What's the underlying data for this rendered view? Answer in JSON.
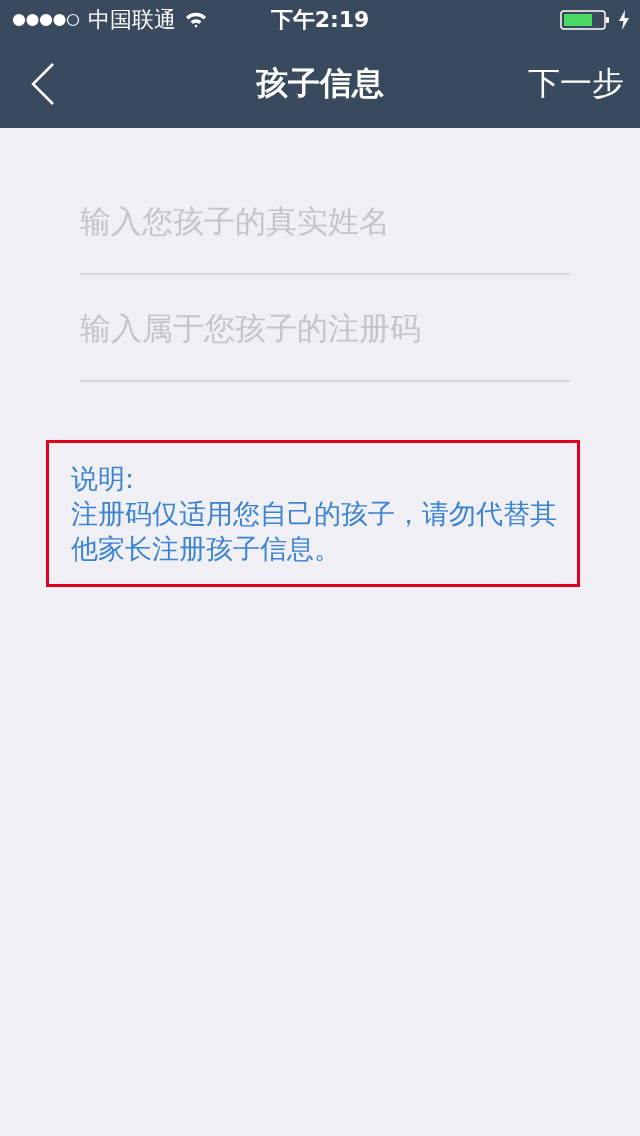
{
  "status_bar": {
    "carrier": "中国联通",
    "time": "下午2:19"
  },
  "nav_bar": {
    "title": "孩子信息",
    "action": "下一步"
  },
  "fields": [
    {
      "placeholder": "输入您孩子的真实姓名"
    },
    {
      "placeholder": "输入属于您孩子的注册码"
    }
  ],
  "note": {
    "label": "说明:",
    "text": "注册码仅适用您自己的孩子，请勿代替其他家长注册孩子信息。"
  }
}
